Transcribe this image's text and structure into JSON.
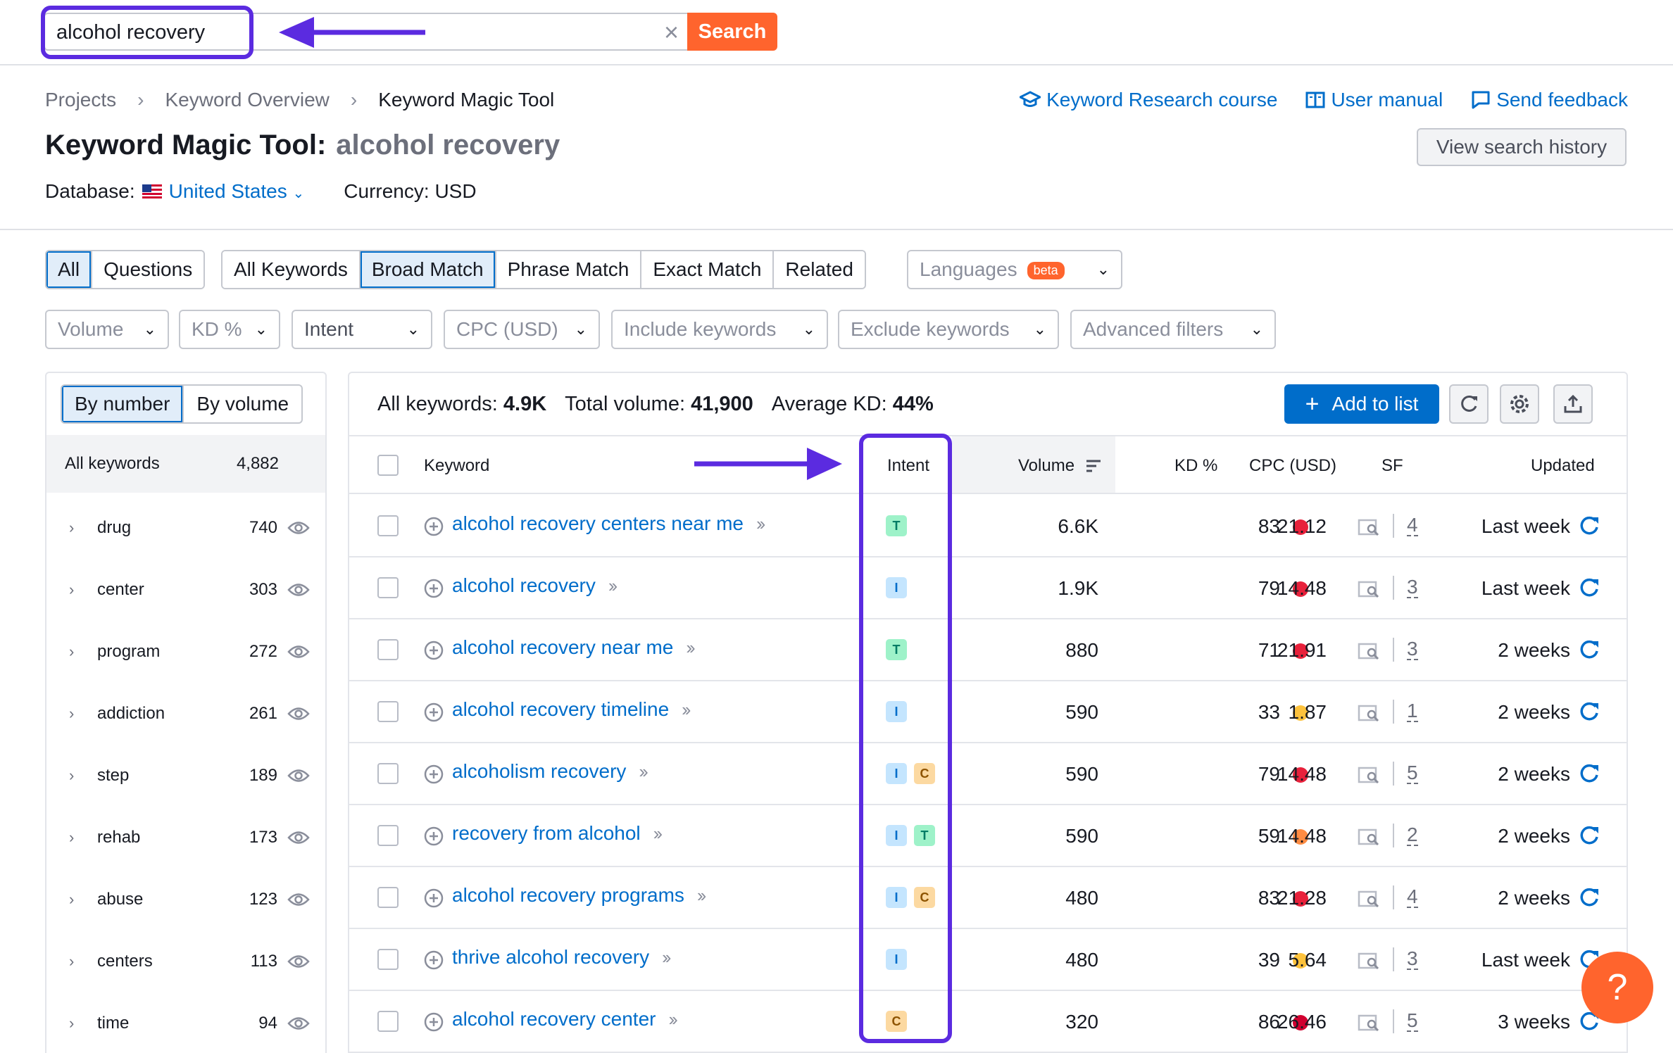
{
  "search": {
    "value": "alcohol recovery",
    "button_label": "Search"
  },
  "breadcrumb": [
    "Projects",
    "Keyword Overview",
    "Keyword Magic Tool"
  ],
  "top_links": {
    "course": "Keyword Research course",
    "manual": "User manual",
    "feedback": "Send feedback"
  },
  "view_history_label": "View search history",
  "title": {
    "tool": "Keyword Magic Tool:",
    "keyword": "alcohol recovery"
  },
  "database": {
    "label": "Database:",
    "value": "United States",
    "currency": "Currency: USD"
  },
  "tabs_group1": [
    "All",
    "Questions"
  ],
  "tabs_group2": [
    "All Keywords",
    "Broad Match",
    "Phrase Match",
    "Exact Match",
    "Related"
  ],
  "languages": {
    "label": "Languages",
    "badge": "beta"
  },
  "filters": [
    "Volume",
    "KD %",
    "Intent",
    "CPC (USD)",
    "Include keywords",
    "Exclude keywords",
    "Advanced filters"
  ],
  "left_panel": {
    "toggle": [
      "By number",
      "By volume"
    ],
    "all_label": "All keywords",
    "all_count": "4,882",
    "groups": [
      {
        "name": "drug",
        "count": "740"
      },
      {
        "name": "center",
        "count": "303"
      },
      {
        "name": "program",
        "count": "272"
      },
      {
        "name": "addiction",
        "count": "261"
      },
      {
        "name": "step",
        "count": "189"
      },
      {
        "name": "rehab",
        "count": "173"
      },
      {
        "name": "abuse",
        "count": "123"
      },
      {
        "name": "centers",
        "count": "113"
      },
      {
        "name": "time",
        "count": "94"
      }
    ]
  },
  "summary": {
    "all_label": "All keywords:",
    "all_value": "4.9K",
    "volume_label": "Total volume:",
    "volume_value": "41,900",
    "kd_label": "Average KD:",
    "kd_value": "44%"
  },
  "add_to_list_label": "Add to list",
  "columns": {
    "keyword": "Keyword",
    "intent": "Intent",
    "volume": "Volume",
    "kd": "KD %",
    "cpc": "CPC (USD)",
    "sf": "SF",
    "updated": "Updated"
  },
  "colors": {
    "accent": "#006dca",
    "brand_orange": "#ff642d",
    "annotation": "#5b2be0",
    "kd_red": "#e8213b",
    "kd_darkred": "#d1002f",
    "kd_orange": "#ff8c43",
    "kd_yellow": "#fdc23c"
  },
  "rows": [
    {
      "keyword": "alcohol recovery centers near me",
      "intents": [
        "T"
      ],
      "volume": "6.6K",
      "kd": "83",
      "kd_color": "#e8213b",
      "cpc": "21.12",
      "sf": "4",
      "updated": "Last week"
    },
    {
      "keyword": "alcohol recovery",
      "intents": [
        "I"
      ],
      "volume": "1.9K",
      "kd": "79",
      "kd_color": "#e8213b",
      "cpc": "14.48",
      "sf": "3",
      "updated": "Last week"
    },
    {
      "keyword": "alcohol recovery near me",
      "intents": [
        "T"
      ],
      "volume": "880",
      "kd": "71",
      "kd_color": "#e8213b",
      "cpc": "21.91",
      "sf": "3",
      "updated": "2 weeks"
    },
    {
      "keyword": "alcohol recovery timeline",
      "intents": [
        "I"
      ],
      "volume": "590",
      "kd": "33",
      "kd_color": "#fdc23c",
      "cpc": "1.87",
      "sf": "1",
      "updated": "2 weeks"
    },
    {
      "keyword": "alcoholism recovery",
      "intents": [
        "I",
        "C"
      ],
      "volume": "590",
      "kd": "79",
      "kd_color": "#e8213b",
      "cpc": "14.48",
      "sf": "5",
      "updated": "2 weeks"
    },
    {
      "keyword": "recovery from alcohol",
      "intents": [
        "I",
        "T"
      ],
      "volume": "590",
      "kd": "59",
      "kd_color": "#ff8c43",
      "cpc": "14.48",
      "sf": "2",
      "updated": "2 weeks"
    },
    {
      "keyword": "alcohol recovery programs",
      "intents": [
        "I",
        "C"
      ],
      "volume": "480",
      "kd": "83",
      "kd_color": "#e8213b",
      "cpc": "21.28",
      "sf": "4",
      "updated": "2 weeks"
    },
    {
      "keyword": "thrive alcohol recovery",
      "intents": [
        "I"
      ],
      "volume": "480",
      "kd": "39",
      "kd_color": "#fdc23c",
      "cpc": "5.64",
      "sf": "3",
      "updated": "Last week"
    },
    {
      "keyword": "alcohol recovery center",
      "intents": [
        "C"
      ],
      "volume": "320",
      "kd": "86",
      "kd_color": "#d1002f",
      "cpc": "26.46",
      "sf": "5",
      "updated": "3 weeks"
    }
  ],
  "help_label": "?"
}
